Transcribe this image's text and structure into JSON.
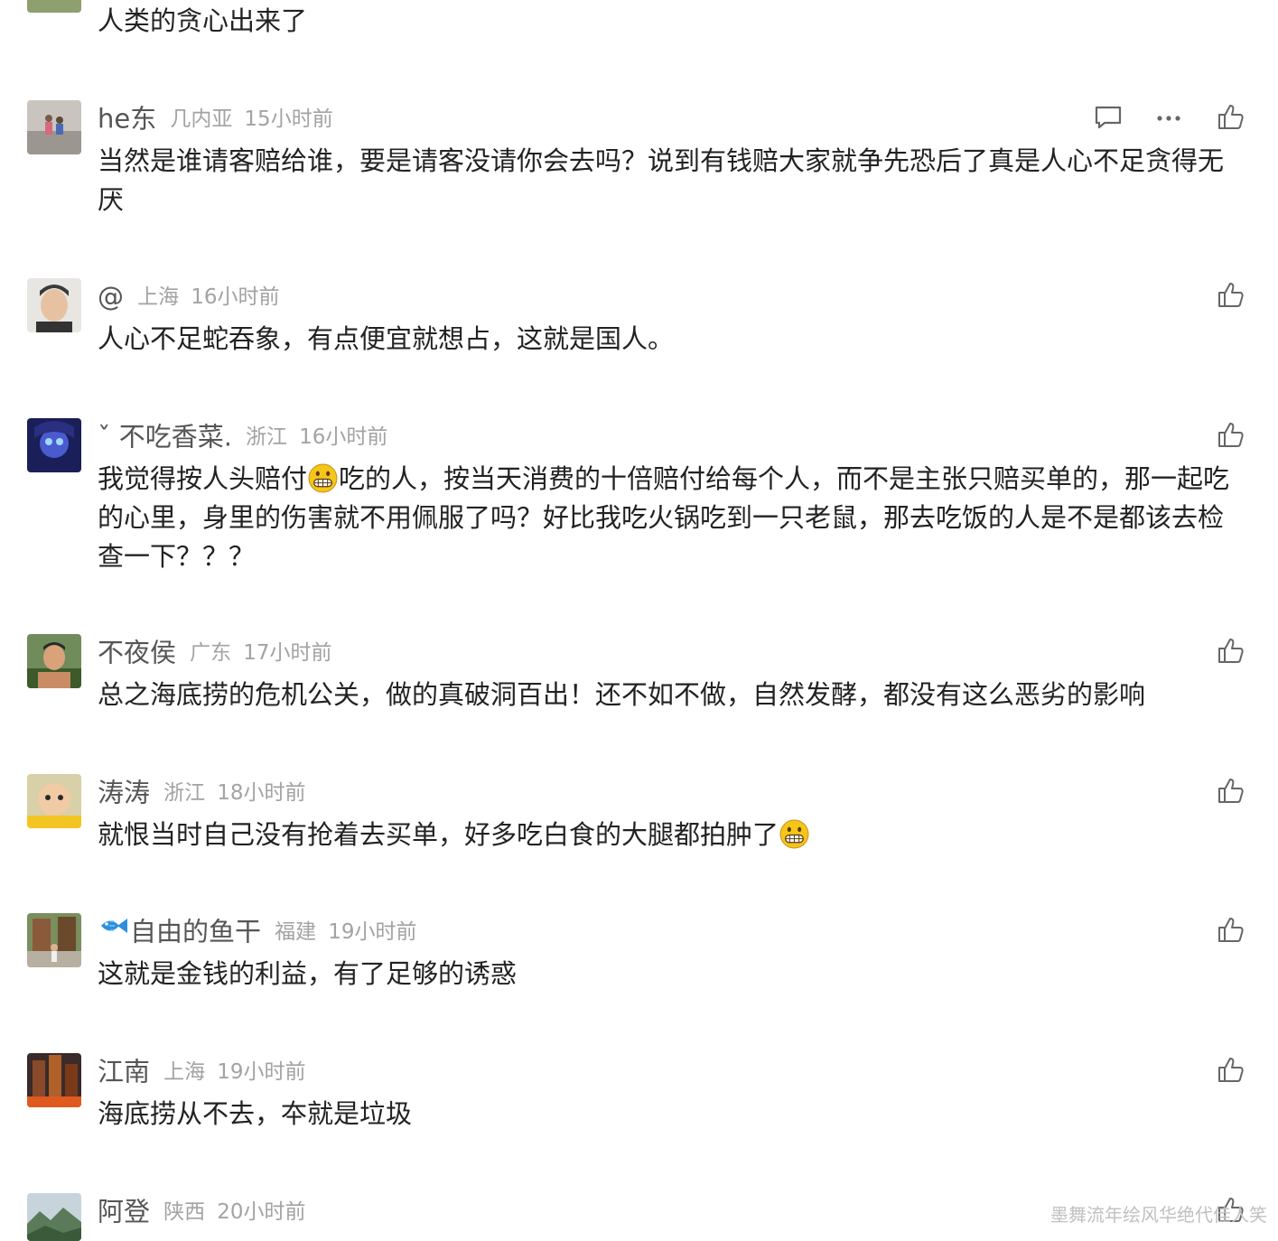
{
  "comments": [
    {
      "username": "",
      "location": "",
      "time": "",
      "text": "人类的贪心出来了"
    },
    {
      "username": "he东",
      "location": "几内亚",
      "time": "15小时前",
      "text": "当然是谁请客赔给谁，要是请客没请你会去吗？说到有钱赔大家就争先恐后了真是人心不足贪得无厌"
    },
    {
      "username": "@",
      "location": "上海",
      "time": "16小时前",
      "text": "人心不足蛇吞象，有点便宜就想占，这就是国人。"
    },
    {
      "username": "ˇ 不吃香菜.",
      "location": "浙江",
      "time": "16小时前",
      "text_before": "我觉得按人头赔付",
      "text_after": "吃的人，按当天消费的十倍赔付给每个人，而不是主张只赔买单的，那一起吃的心里，身里的伤害就不用佩服了吗？好比我吃火锅吃到一只老鼠，那去吃饭的人是不是都该去检查一下？？？"
    },
    {
      "username": "不夜侯",
      "location": "广东",
      "time": "17小时前",
      "text": "总之海底捞的危机公关，做的真破洞百出！还不如不做，自然发酵，都没有这么恶劣的影响"
    },
    {
      "username": "涛涛",
      "location": "浙江",
      "time": "18小时前",
      "text": "就恨当时自己没有抢着去买单，好多吃白食的大腿都拍肿了"
    },
    {
      "username": "自由的鱼干",
      "location": "福建",
      "time": "19小时前",
      "text": "这就是金钱的利益，有了足够的诱惑"
    },
    {
      "username": "江南",
      "location": "上海",
      "time": "19小时前",
      "text": "海底捞从不去，夲就是垃圾"
    },
    {
      "username": "阿登",
      "location": "陕西",
      "time": "20小时前",
      "text": ""
    }
  ],
  "icons": {
    "like": "thumbs-up-icon",
    "reply": "comment-bubble-icon",
    "more": "more-dots-icon",
    "emoji": "grinning-face-emoji",
    "badge": "fish-badge-icon"
  },
  "colors": {
    "username": "#555555",
    "meta": "#a3a3a3",
    "text": "#222222",
    "icon": "#666666",
    "emoji": "#f5c518"
  },
  "watermark": "墨舞流年绘风华绝代佳人笑"
}
